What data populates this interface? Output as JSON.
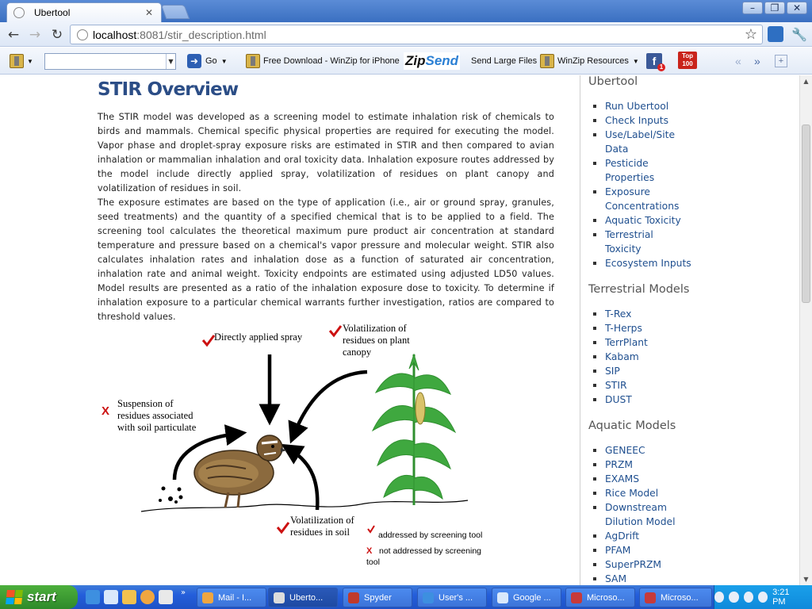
{
  "browser": {
    "tab_title": "Ubertool",
    "url_host": "localhost",
    "url_rest": ":8081/stir_description.html"
  },
  "toolbar": {
    "go_label": "Go",
    "winzip_iphone": "Free Download - WinZip for iPhone",
    "zipsend_zip": "Zip",
    "zipsend_send": "Send",
    "send_large_files": "Send Large Files",
    "winzip_resources": "WinZip Resources",
    "top100_label": "Top 100"
  },
  "content": {
    "title": "STIR Overview",
    "paragraphs": [
      "The STIR model was developed as a screening model to estimate inhalation risk of chemicals to birds and mammals. Chemical specific physical properties are required for executing the model. Vapor phase and droplet-spray exposure risks are estimated in STIR and then compared to avian inhalation or mammalian inhalation and oral toxicity data. Inhalation exposure routes addressed by the model include directly applied spray, volatilization of residues on plant canopy and volatilization of residues in soil.",
      "The exposure estimates are based on the type of application (i.e., air or ground spray, granules, seed treatments) and the quantity of a specified chemical that is to be applied to a field. The screening tool calculates the theoretical maximum pure product air concentration at standard temperature and pressure based on a chemical's vapor pressure and molecular weight. STIR also calculates inhalation rates and inhalation dose as a function of saturated air concentration, inhalation rate and animal weight. Toxicity endpoints are estimated using adjusted LD50 values. Model results are presented as a ratio of the inhalation exposure dose to toxicity. To determine if inhalation exposure to a particular chemical warrants further investigation, ratios are compared to threshold values."
    ]
  },
  "figure": {
    "directly_applied": "Directly applied spray",
    "vol_canopy_1": "Volatilization of",
    "vol_canopy_2": "residues on plant",
    "vol_canopy_3": "canopy",
    "suspension_1": "Suspension of",
    "suspension_2": "residues associated",
    "suspension_3": "with soil particulate",
    "vol_soil_1": "Volatilization of",
    "vol_soil_2": "residues in soil",
    "legend_addressed": "addressed by screening tool",
    "legend_not_1": "not addressed by screening",
    "legend_not_2": "tool",
    "mark_x": "X",
    "colors": {
      "check_red": "#cc1111",
      "plant_green": "#2f8f2f",
      "arrow_black": "#000000"
    }
  },
  "sidebar": {
    "sections": [
      {
        "heading": "Ubertool",
        "items": [
          "Run Ubertool",
          "Check Inputs",
          "Use/Label/Site Data",
          "Pesticide Properties",
          "Exposure Concentrations",
          "Aquatic Toxicity",
          "Terrestrial Toxicity",
          "Ecosystem Inputs"
        ]
      },
      {
        "heading": "Terrestrial Models",
        "items": [
          "T-Rex",
          "T-Herps",
          "TerrPlant",
          "Kabam",
          "SIP",
          "STIR",
          "DUST"
        ]
      },
      {
        "heading": "Aquatic Models",
        "items": [
          "GENEEC",
          "PRZM",
          "EXAMS",
          "Rice Model",
          "Downstream Dilution Model",
          "AgDrift",
          "PFAM",
          "SuperPRZM",
          "SAM"
        ]
      }
    ]
  },
  "taskbar": {
    "start_label": "start",
    "tasks": [
      "Mail - I...",
      "Uberto...",
      "Spyder",
      "User's ...",
      "Google ...",
      "Microso...",
      "Microso..."
    ],
    "clock": "3:21 PM"
  }
}
